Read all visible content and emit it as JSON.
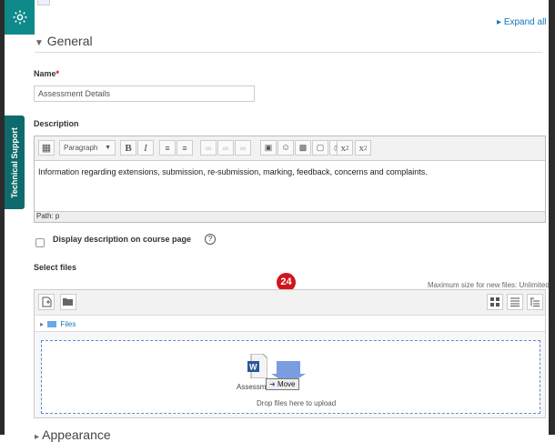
{
  "header": {
    "expand_all": "Expand all"
  },
  "sidebar": {
    "support_label": "Technical Support"
  },
  "general": {
    "legend": "General"
  },
  "name_field": {
    "label": "Name",
    "required_marker": "*",
    "value": "Assessment Details"
  },
  "description": {
    "label": "Description",
    "paragraph_select": "Paragraph",
    "content": "Information regarding extensions, submission, re-submission, marking, feedback, concerns and complaints.",
    "path": "Path: p"
  },
  "display_on_course": {
    "label": "Display description on course page",
    "checked": false
  },
  "files": {
    "label": "Select files",
    "max_size": "Maximum size for new files: Unlimited",
    "folder_path": "Files",
    "drop_hint": "Drop files here to upload",
    "dragged_file_name": "Assessment det...",
    "drag_action": "Move"
  },
  "step_badge": "24",
  "next_section": {
    "legend": "Appearance"
  },
  "colors": {
    "accent_teal": "#0f8a8a",
    "badge_red": "#d0161c",
    "link_blue": "#1177bb"
  }
}
